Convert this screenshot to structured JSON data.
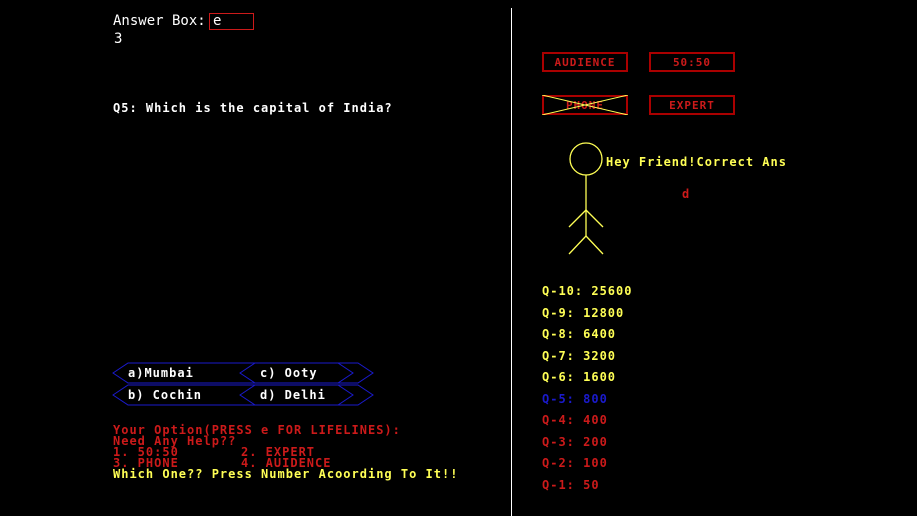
{
  "answer_box": {
    "label": "Answer Box:",
    "value": "e",
    "below_value": "3"
  },
  "question": {
    "text": "Q5: Which is the capital of India?"
  },
  "options": [
    {
      "label": "a)Mumbai"
    },
    {
      "label": "c) Ooty"
    },
    {
      "label": "b) Cochin"
    },
    {
      "label": "d) Delhi"
    }
  ],
  "instructions": {
    "line1": "Your Option(PRESS e FOR LIFELINES):",
    "line2": "Need Any Help??",
    "line3a": "1. 50:50",
    "line3b": "2. EXPERT",
    "line4a": "3. PHONE",
    "line4b": "4. AUIDENCE",
    "line5": "Which One?? Press Number Acoording To It!!"
  },
  "lifelines": {
    "audience": "AUDIENCE",
    "fifty_fifty": "50:50",
    "phone": "PHONE",
    "expert": "EXPERT",
    "phone_used": true
  },
  "friend": {
    "message": "Hey Friend!Correct Ans",
    "answer": "d"
  },
  "prize_ladder": [
    {
      "label": "Q-10: 25600",
      "status": "upcoming"
    },
    {
      "label": "Q-9: 12800",
      "status": "upcoming"
    },
    {
      "label": "Q-8: 6400",
      "status": "upcoming"
    },
    {
      "label": "Q-7: 3200",
      "status": "upcoming"
    },
    {
      "label": "Q-6: 1600",
      "status": "upcoming"
    },
    {
      "label": "Q-5: 800",
      "status": "current"
    },
    {
      "label": "Q-4: 400",
      "status": "done"
    },
    {
      "label": "Q-3: 200",
      "status": "done"
    },
    {
      "label": "Q-2: 100",
      "status": "done"
    },
    {
      "label": "Q-1: 50",
      "status": "done"
    }
  ],
  "colors": {
    "upcoming": "#ffff55",
    "current": "#1a1acc",
    "done": "#cc1a1a",
    "option_border": "#1a1acc"
  }
}
